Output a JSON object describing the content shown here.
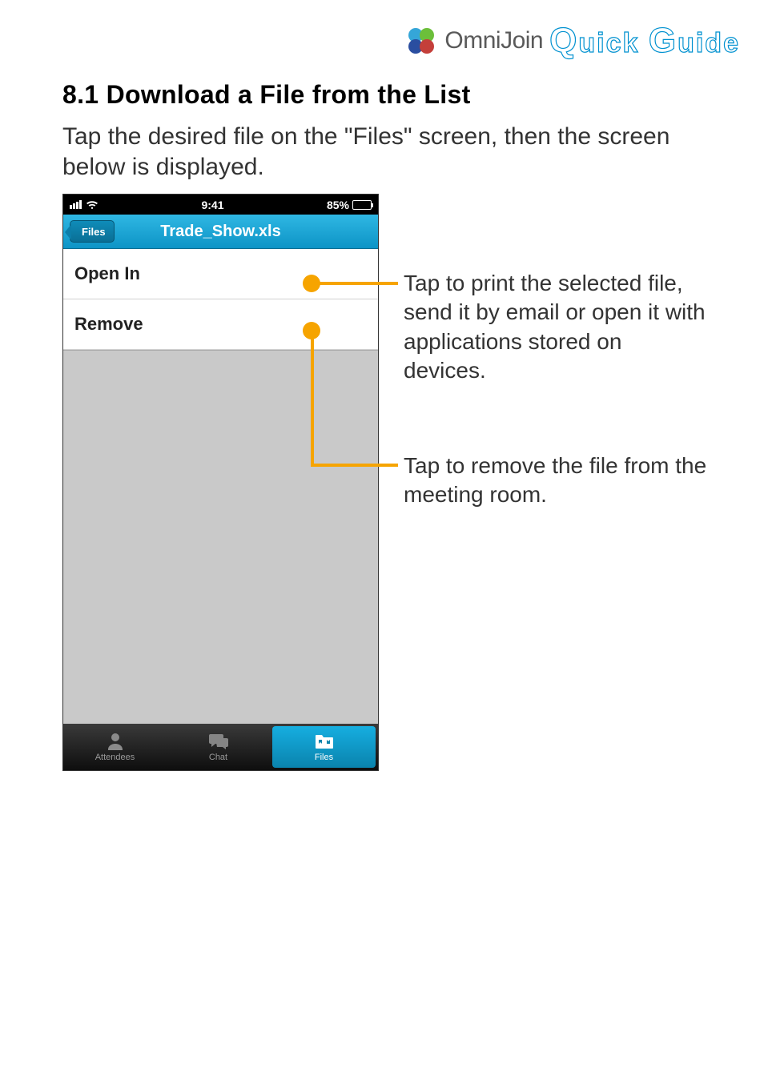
{
  "header": {
    "brand": "OmniJoin",
    "quick_Q": "Q",
    "quick_rest": "uick",
    "guide_G": "G",
    "guide_rest": "uide"
  },
  "section": {
    "title": "8.1 Download a File from the List",
    "intro": "Tap the desired file on the \"Files\" screen, then the screen below is displayed."
  },
  "phone": {
    "status": {
      "time": "9:41",
      "battery_pct": "85%"
    },
    "nav": {
      "back_label": "Files",
      "title": "Trade_Show.xls"
    },
    "rows": {
      "open_in": "Open In",
      "remove": "Remove"
    },
    "tabs": {
      "attendees": "Attendees",
      "chat": "Chat",
      "files": "Files"
    }
  },
  "callouts": {
    "open_in": "Tap to print the selected file, send it by email or open it with applications stored on devices.",
    "remove": "Tap to remove the file from the meeting room."
  }
}
